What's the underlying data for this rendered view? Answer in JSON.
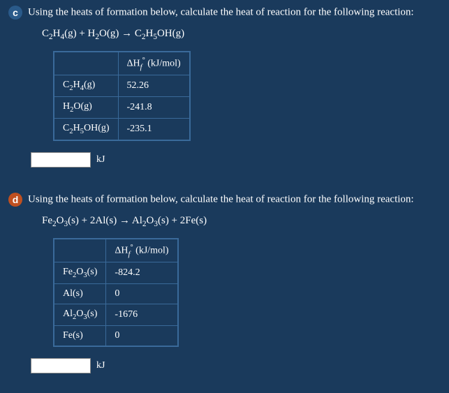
{
  "qc": {
    "badge": "c",
    "prompt": "Using the heats of formation below, calculate the heat of reaction for the following reaction:",
    "equation": "C₂H₄(g) + H₂O(g) → C₂H₅OH(g)",
    "header_col": "ΔH𝑓° (kJ/mol)",
    "rows": [
      {
        "species": "C₂H₄(g)",
        "dhf": "52.26"
      },
      {
        "species": "H₂O(g)",
        "dhf": "-241.8"
      },
      {
        "species": "C₂H₅OH(g)",
        "dhf": "-235.1"
      }
    ],
    "unit": "kJ"
  },
  "qd": {
    "badge": "d",
    "prompt": "Using the heats of formation below, calculate the heat of reaction for the following reaction:",
    "equation": "Fe₂O₃(s) + 2Al(s) → Al₂O₃(s) + 2Fe(s)",
    "header_col": "ΔH𝑓° (kJ/mol)",
    "rows": [
      {
        "species": "Fe₂O₃(s)",
        "dhf": "-824.2"
      },
      {
        "species": "Al(s)",
        "dhf": "0"
      },
      {
        "species": "Al₂O₃(s)",
        "dhf": "-1676"
      },
      {
        "species": "Fe(s)",
        "dhf": "0"
      }
    ],
    "unit": "kJ"
  }
}
